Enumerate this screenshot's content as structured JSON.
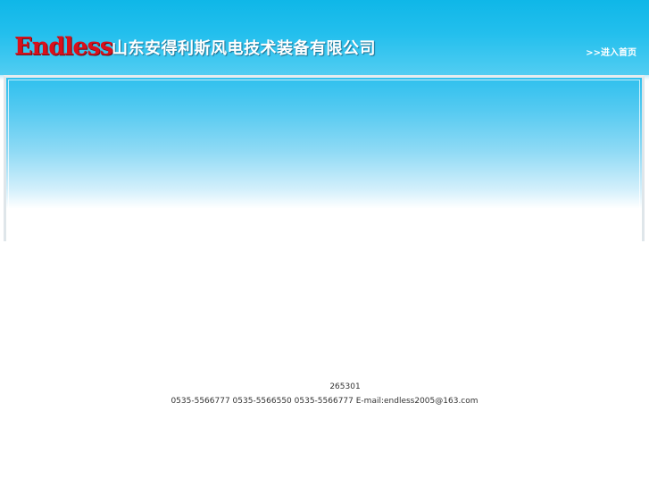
{
  "header": {
    "logo_text": "Endless",
    "company_name": "山东安得利斯风电技术装备有限公司",
    "home_link_label": ">>进入首页"
  },
  "footer": {
    "postal_code": "265301",
    "contact_line": "0535-5566777 0535-5566550   0535-5566777 E-mail:endless2005@163.com"
  },
  "colors": {
    "header_blue": "#11b9e8",
    "logo_red": "#d9101b",
    "text_white": "#ffffff"
  }
}
